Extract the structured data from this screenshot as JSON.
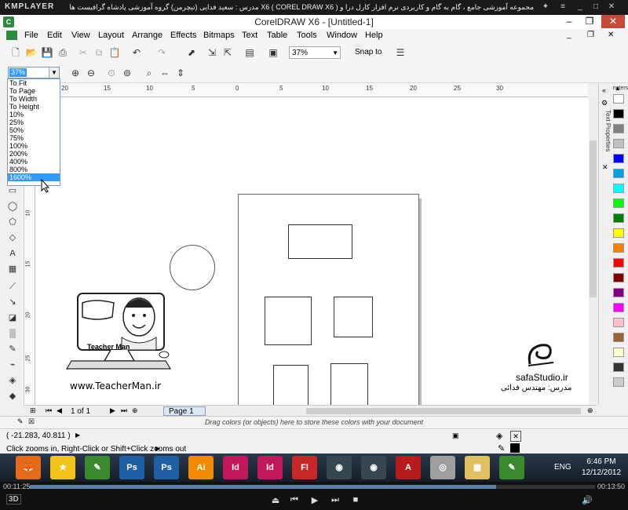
{
  "player": {
    "logo": "KMPLAYER",
    "title": "مجموعه آموزشی جامع ، گام به گام و کاربردی نرم افزار کارل درا و X6 ( COREL DRAW X6 )  مدرس : سعید فدایی (تیچرمن) گروه آموزشی پادشاه گرافیست ها",
    "time_current": "00:11:25",
    "time_total": "00:13:50",
    "progress_fraction": 0.825,
    "label_3d": "3D"
  },
  "window": {
    "title": "CorelDRAW X6 - [Untitled-1]",
    "minimize": "–",
    "restore": "❐",
    "close": "✕"
  },
  "menu": [
    "File",
    "Edit",
    "View",
    "Layout",
    "Arrange",
    "Effects",
    "Bitmaps",
    "Text",
    "Table",
    "Tools",
    "Window",
    "Help"
  ],
  "toolbar": {
    "zoom_value": "37%",
    "snap_label": "Snap to"
  },
  "property_bar": {
    "zoom_selected": "37%"
  },
  "zoom_options": [
    "To Fit",
    "To Page",
    "To Width",
    "To Height",
    "10%",
    "25%",
    "50%",
    "75%",
    "100%",
    "200%",
    "400%",
    "800%",
    "1600%"
  ],
  "zoom_highlight_index": 12,
  "ruler": {
    "unit": "centimeters",
    "top_labels": [
      "20",
      "15",
      "10",
      "5",
      "0",
      "5",
      "10",
      "15",
      "20",
      "25",
      "30"
    ],
    "left_labels": [
      "10",
      "15",
      "20",
      "25",
      "30"
    ]
  },
  "page_nav": {
    "counter": "1 of 1",
    "tab": "Page 1"
  },
  "docker": {
    "label": "Text Properties"
  },
  "palette_colors": [
    "#ffffff",
    "#000000",
    "#808080",
    "#c0c0c0",
    "#0000ff",
    "#00a0e0",
    "#00ffff",
    "#00ff00",
    "#008000",
    "#ffff00",
    "#ff8000",
    "#ff0000",
    "#800000",
    "#800080",
    "#ff00ff",
    "#ffc0cb",
    "#996633",
    "#ffffcc",
    "#333333",
    "#cccccc"
  ],
  "doc_palette": "Drag colors (or objects) here to store these colors with your document",
  "status": {
    "coords": "( -21.283, 40.811 )",
    "message": "Click zooms in, Right-Click or Shift+Click zooms out"
  },
  "watermark": {
    "teacherman_url": "www.TeacherMan.ir",
    "teacherman_name": "Teacher Man",
    "safa": "safaStudio.ir",
    "safa_teacher": "مدرس: مهندس فدائی"
  },
  "taskbar": {
    "apps": [
      "Firefox",
      "Star",
      "CorelDRAW",
      "Ps",
      "Ps",
      "Ai",
      "Id",
      "Id",
      "Fl",
      "Cinema",
      "Cinema",
      "Acrobat",
      "Disc",
      "Folder",
      "CorelDRAW"
    ],
    "lang": "ENG",
    "time": "6:46 PM",
    "date": "12/12/2012"
  }
}
